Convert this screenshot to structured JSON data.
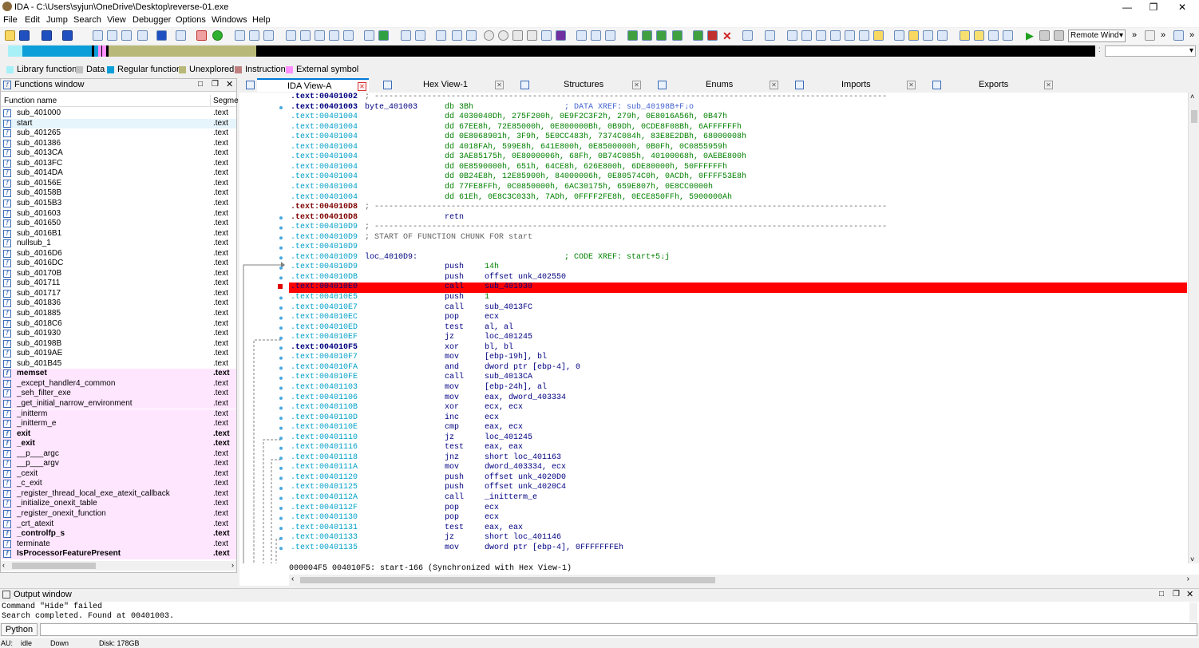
{
  "window": {
    "title": "IDA - C:\\Users\\syjun\\OneDrive\\Desktop\\reverse-01.exe",
    "minimize": "—",
    "maximize": "❐",
    "close": "✕"
  },
  "menu": [
    "File",
    "Edit",
    "Jump",
    "Search",
    "View",
    "Debugger",
    "Options",
    "Windows",
    "Help"
  ],
  "toolbar": {
    "debugger_select": "Remote Wind",
    "more": "»"
  },
  "legend": [
    {
      "label": "Library function",
      "color": "#a8f0f8"
    },
    {
      "label": "Data",
      "color": "#c0c0c0"
    },
    {
      "label": "Regular function",
      "color": "#0c9ed8"
    },
    {
      "label": "Unexplored",
      "color": "#b8b878"
    },
    {
      "label": "Instruction",
      "color": "#c08080"
    },
    {
      "label": "External symbol",
      "color": "#ff90ff"
    }
  ],
  "functions_window": {
    "title": "Functions window",
    "col_name": "Function name",
    "col_segment": "Segme",
    "rows": [
      {
        "name": "sub_401000",
        "seg": ".text",
        "kind": "regular"
      },
      {
        "name": "start",
        "seg": ".text",
        "kind": "selected"
      },
      {
        "name": "sub_401265",
        "seg": ".text",
        "kind": "regular"
      },
      {
        "name": "sub_401386",
        "seg": ".text",
        "kind": "regular"
      },
      {
        "name": "sub_4013CA",
        "seg": ".text",
        "kind": "regular"
      },
      {
        "name": "sub_4013FC",
        "seg": ".text",
        "kind": "regular"
      },
      {
        "name": "sub_4014DA",
        "seg": ".text",
        "kind": "regular"
      },
      {
        "name": "sub_40156E",
        "seg": ".text",
        "kind": "regular"
      },
      {
        "name": "sub_40158B",
        "seg": ".text",
        "kind": "regular"
      },
      {
        "name": "sub_4015B3",
        "seg": ".text",
        "kind": "regular"
      },
      {
        "name": "sub_401603",
        "seg": ".text",
        "kind": "regular"
      },
      {
        "name": "sub_401650",
        "seg": ".text",
        "kind": "regular"
      },
      {
        "name": "sub_4016B1",
        "seg": ".text",
        "kind": "regular"
      },
      {
        "name": "nullsub_1",
        "seg": ".text",
        "kind": "regular"
      },
      {
        "name": "sub_4016D6",
        "seg": ".text",
        "kind": "regular"
      },
      {
        "name": "sub_4016DC",
        "seg": ".text",
        "kind": "regular"
      },
      {
        "name": "sub_40170B",
        "seg": ".text",
        "kind": "regular"
      },
      {
        "name": "sub_401711",
        "seg": ".text",
        "kind": "regular"
      },
      {
        "name": "sub_401717",
        "seg": ".text",
        "kind": "regular"
      },
      {
        "name": "sub_401836",
        "seg": ".text",
        "kind": "regular"
      },
      {
        "name": "sub_401885",
        "seg": ".text",
        "kind": "regular"
      },
      {
        "name": "sub_4018C6",
        "seg": ".text",
        "kind": "regular"
      },
      {
        "name": "sub_401930",
        "seg": ".text",
        "kind": "regular"
      },
      {
        "name": "sub_40198B",
        "seg": ".text",
        "kind": "regular"
      },
      {
        "name": "sub_4019AE",
        "seg": ".text",
        "kind": "regular"
      },
      {
        "name": "sub_401B45",
        "seg": ".text",
        "kind": "regular"
      },
      {
        "name": "memset",
        "seg": ".text",
        "kind": "lib-bold"
      },
      {
        "name": "_except_handler4_common",
        "seg": ".text",
        "kind": "lib"
      },
      {
        "name": "_seh_filter_exe",
        "seg": ".text",
        "kind": "lib"
      },
      {
        "name": "_get_initial_narrow_environment",
        "seg": ".text",
        "kind": "lib"
      },
      {
        "name": "_initterm",
        "seg": ".text",
        "kind": "lib"
      },
      {
        "name": "_initterm_e",
        "seg": ".text",
        "kind": "lib"
      },
      {
        "name": "exit",
        "seg": ".text",
        "kind": "lib-bold"
      },
      {
        "name": "_exit",
        "seg": ".text",
        "kind": "lib-bold"
      },
      {
        "name": "__p___argc",
        "seg": ".text",
        "kind": "lib"
      },
      {
        "name": "__p___argv",
        "seg": ".text",
        "kind": "lib"
      },
      {
        "name": "_cexit",
        "seg": ".text",
        "kind": "lib"
      },
      {
        "name": "_c_exit",
        "seg": ".text",
        "kind": "lib"
      },
      {
        "name": "_register_thread_local_exe_atexit_callback",
        "seg": ".text",
        "kind": "lib"
      },
      {
        "name": "_initialize_onexit_table",
        "seg": ".text",
        "kind": "lib"
      },
      {
        "name": "_register_onexit_function",
        "seg": ".text",
        "kind": "lib"
      },
      {
        "name": "_crt_atexit",
        "seg": ".text",
        "kind": "lib"
      },
      {
        "name": "_controlfp_s",
        "seg": ".text",
        "kind": "lib-bold"
      },
      {
        "name": "terminate",
        "seg": ".text",
        "kind": "lib"
      },
      {
        "name": "IsProcessorFeaturePresent",
        "seg": ".text",
        "kind": "lib-bold"
      }
    ]
  },
  "tabs": [
    {
      "label": "IDA View-A",
      "active": true
    },
    {
      "label": "Hex View-1",
      "active": false
    },
    {
      "label": "Structures",
      "active": false
    },
    {
      "label": "Enums",
      "active": false
    },
    {
      "label": "Imports",
      "active": false
    },
    {
      "label": "Exports",
      "active": false
    }
  ],
  "disasm": [
    {
      "addr": ".text:00401002",
      "label": "",
      "mn": "; -----------------------------------------------------------------------------------------------------------",
      "op": "",
      "cm": "",
      "kind": "sep-bold"
    },
    {
      "addr": ".text:00401003",
      "label": "byte_401003",
      "mn": "db 3Bh",
      "op": "",
      "cm": "; DATA XREF: sub_40198B+F↓o",
      "kind": "data-bold"
    },
    {
      "addr": ".text:00401004",
      "label": "",
      "mn": "dd 4030040Dh, 275F200h, 0E9F2C3F2h, 279h, 0E8016A56h, 0B47h",
      "op": "",
      "cm": "",
      "kind": "data"
    },
    {
      "addr": ".text:00401004",
      "label": "",
      "mn": "dd 67EE8h, 72E85000h, 0E800000Bh, 0B9Dh, 0CDE8F08Bh, 6AFFFFFFh",
      "op": "",
      "cm": "",
      "kind": "data"
    },
    {
      "addr": ".text:00401004",
      "label": "",
      "mn": "dd 0E8068901h, 3F9h, 5E0CC483h, 7374C084h, 83E8E2DBh, 68000008h",
      "op": "",
      "cm": "",
      "kind": "data"
    },
    {
      "addr": ".text:00401004",
      "label": "",
      "mn": "dd 4018FAh, 599E8h, 641E800h, 0E8500000h, 0B0Fh, 0C0855959h",
      "op": "",
      "cm": "",
      "kind": "data"
    },
    {
      "addr": ".text:00401004",
      "label": "",
      "mn": "dd 3AE85175h, 0E8000006h, 68Fh, 0B74C085h, 40100068h, 0AEBE800h",
      "op": "",
      "cm": "",
      "kind": "data"
    },
    {
      "addr": ".text:00401004",
      "label": "",
      "mn": "dd 0E8590000h, 651h, 64CE8h, 626E800h, 6DE80000h, 50FFFFFFh",
      "op": "",
      "cm": "",
      "kind": "data"
    },
    {
      "addr": ".text:00401004",
      "label": "",
      "mn": "dd 0B24E8h, 12E85900h, 84000006h, 0E80574C0h, 0ACDh, 0FFFF53E8h",
      "op": "",
      "cm": "",
      "kind": "data"
    },
    {
      "addr": ".text:00401004",
      "label": "",
      "mn": "dd 77FE8FFh, 0C0850000h, 6AC30175h, 659E807h, 0E8CC0000h",
      "op": "",
      "cm": "",
      "kind": "data"
    },
    {
      "addr": ".text:00401004",
      "label": "",
      "mn": "dd 61Eh, 0E8C3C033h, 7ADh, 0FFFF2FE8h, 0ECE850FFh, 5900000Ah",
      "op": "",
      "cm": "",
      "kind": "data"
    },
    {
      "addr": ".text:004010D8",
      "label": "",
      "mn": "; -----------------------------------------------------------------------------------------------------------",
      "op": "",
      "cm": "",
      "kind": "sep-dark"
    },
    {
      "addr": ".text:004010D8",
      "label": "",
      "mn": "retn",
      "op": "",
      "cm": "",
      "kind": "code-dark"
    },
    {
      "addr": ".text:004010D9",
      "label": "",
      "mn": "; -----------------------------------------------------------------------------------------------------------",
      "op": "",
      "cm": "",
      "kind": "sep"
    },
    {
      "addr": ".text:004010D9",
      "label": "",
      "mn": "; START OF FUNCTION CHUNK FOR start",
      "op": "",
      "cm": "",
      "kind": "comment"
    },
    {
      "addr": ".text:004010D9",
      "label": "",
      "mn": "",
      "op": "",
      "cm": "",
      "kind": "code"
    },
    {
      "addr": ".text:004010D9",
      "label": "loc_4010D9:",
      "mn": "",
      "op": "",
      "cm": "; CODE XREF: start+5↓j",
      "kind": "code"
    },
    {
      "addr": ".text:004010D9",
      "label": "",
      "mn": "push",
      "op": "14h",
      "cm": "",
      "kind": "code"
    },
    {
      "addr": ".text:004010DB",
      "label": "",
      "mn": "push",
      "op": "offset unk_402550",
      "cm": "",
      "kind": "code"
    },
    {
      "addr": ".text:004010E0",
      "label": "",
      "mn": "call",
      "op": "sub_401930",
      "cm": "",
      "kind": "hl"
    },
    {
      "addr": ".text:004010E5",
      "label": "",
      "mn": "push",
      "op": "1",
      "cm": "",
      "kind": "code"
    },
    {
      "addr": ".text:004010E7",
      "label": "",
      "mn": "call",
      "op": "sub_4013FC",
      "cm": "",
      "kind": "code"
    },
    {
      "addr": ".text:004010EC",
      "label": "",
      "mn": "pop",
      "op": "ecx",
      "cm": "",
      "kind": "code"
    },
    {
      "addr": ".text:004010ED",
      "label": "",
      "mn": "test",
      "op": "al, al",
      "cm": "",
      "kind": "code"
    },
    {
      "addr": ".text:004010EF",
      "label": "",
      "mn": "jz",
      "op": "loc_401245",
      "cm": "",
      "kind": "code"
    },
    {
      "addr": ".text:004010F5",
      "label": "",
      "mn": "xor",
      "op": "bl, bl",
      "cm": "",
      "kind": "code-cur"
    },
    {
      "addr": ".text:004010F7",
      "label": "",
      "mn": "mov",
      "op": "[ebp-19h], bl",
      "cm": "",
      "kind": "code"
    },
    {
      "addr": ".text:004010FA",
      "label": "",
      "mn": "and",
      "op": "dword ptr [ebp-4], 0",
      "cm": "",
      "kind": "code"
    },
    {
      "addr": ".text:004010FE",
      "label": "",
      "mn": "call",
      "op": "sub_4013CA",
      "cm": "",
      "kind": "code"
    },
    {
      "addr": ".text:00401103",
      "label": "",
      "mn": "mov",
      "op": "[ebp-24h], al",
      "cm": "",
      "kind": "code"
    },
    {
      "addr": ".text:00401106",
      "label": "",
      "mn": "mov",
      "op": "eax, dword_403334",
      "cm": "",
      "kind": "code"
    },
    {
      "addr": ".text:0040110B",
      "label": "",
      "mn": "xor",
      "op": "ecx, ecx",
      "cm": "",
      "kind": "code"
    },
    {
      "addr": ".text:0040110D",
      "label": "",
      "mn": "inc",
      "op": "ecx",
      "cm": "",
      "kind": "code"
    },
    {
      "addr": ".text:0040110E",
      "label": "",
      "mn": "cmp",
      "op": "eax, ecx",
      "cm": "",
      "kind": "code"
    },
    {
      "addr": ".text:00401110",
      "label": "",
      "mn": "jz",
      "op": "loc_401245",
      "cm": "",
      "kind": "code"
    },
    {
      "addr": ".text:00401116",
      "label": "",
      "mn": "test",
      "op": "eax, eax",
      "cm": "",
      "kind": "code"
    },
    {
      "addr": ".text:00401118",
      "label": "",
      "mn": "jnz",
      "op": "short loc_401163",
      "cm": "",
      "kind": "code"
    },
    {
      "addr": ".text:0040111A",
      "label": "",
      "mn": "mov",
      "op": "dword_403334, ecx",
      "cm": "",
      "kind": "code"
    },
    {
      "addr": ".text:00401120",
      "label": "",
      "mn": "push",
      "op": "offset unk_4020D0",
      "cm": "",
      "kind": "code"
    },
    {
      "addr": ".text:00401125",
      "label": "",
      "mn": "push",
      "op": "offset unk_4020C4",
      "cm": "",
      "kind": "code"
    },
    {
      "addr": ".text:0040112A",
      "label": "",
      "mn": "call",
      "op": "_initterm_e",
      "cm": "",
      "kind": "code"
    },
    {
      "addr": ".text:0040112F",
      "label": "",
      "mn": "pop",
      "op": "ecx",
      "cm": "",
      "kind": "code"
    },
    {
      "addr": ".text:00401130",
      "label": "",
      "mn": "pop",
      "op": "ecx",
      "cm": "",
      "kind": "code"
    },
    {
      "addr": ".text:00401131",
      "label": "",
      "mn": "test",
      "op": "eax, eax",
      "cm": "",
      "kind": "code"
    },
    {
      "addr": ".text:00401133",
      "label": "",
      "mn": "jz",
      "op": "short loc_401146",
      "cm": "",
      "kind": "code"
    },
    {
      "addr": ".text:00401135",
      "label": "",
      "mn": "mov",
      "op": "dword ptr [ebp-4], 0FFFFFFFEh",
      "cm": "",
      "kind": "code"
    }
  ],
  "disasm_status": "000004F5 004010F5: start-166 (Synchronized with Hex View-1)",
  "output": {
    "title": "Output window",
    "lines": [
      "Command \"Hide\" failed",
      "Search completed. Found at 00401003."
    ],
    "python_btn": "Python"
  },
  "statusbar": {
    "au": "AU:",
    "state": "idle",
    "dir": "Down",
    "disk": "Disk: 178GB"
  },
  "colors": {
    "addr_cyan": "#00a0c8",
    "addr_navy": "#000080",
    "addr_dark": "#800000",
    "data_green": "#008000",
    "comment_blue": "#4060d0",
    "highlight": "#ff0000",
    "lib_bg": "#ffe6ff"
  }
}
